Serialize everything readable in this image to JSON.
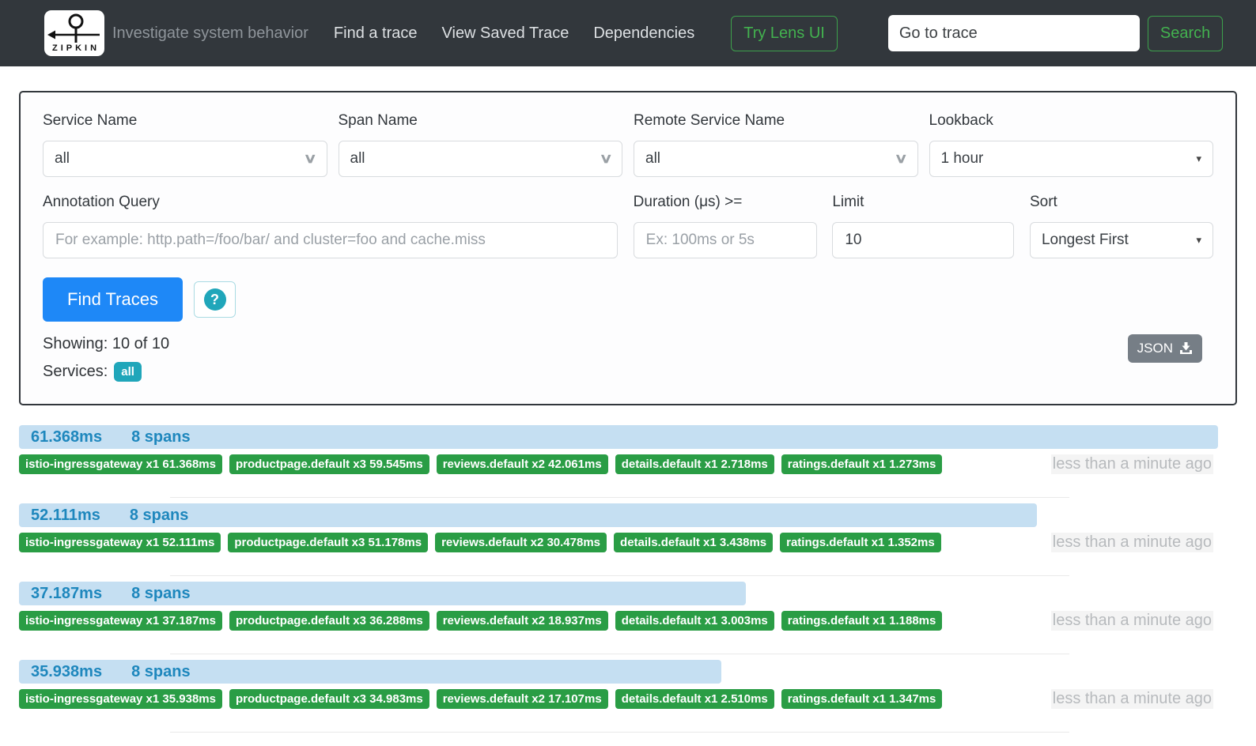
{
  "icons": {
    "chevron_down": "∨",
    "dropdown_arrow": "▾",
    "help_glyph": "?"
  },
  "header": {
    "logo_text": "ZIPKIN",
    "tagline": "Investigate system behavior",
    "nav": [
      {
        "label": "Find a trace"
      },
      {
        "label": "View Saved Trace"
      },
      {
        "label": "Dependencies"
      }
    ],
    "try_lens_label": "Try Lens UI",
    "go_to_trace_placeholder": "Go to trace",
    "search_label": "Search"
  },
  "filters": {
    "service_name": {
      "label": "Service Name",
      "value": "all"
    },
    "span_name": {
      "label": "Span Name",
      "value": "all"
    },
    "remote_service_name": {
      "label": "Remote Service Name",
      "value": "all"
    },
    "lookback": {
      "label": "Lookback",
      "value": "1 hour"
    },
    "annotation_query": {
      "label": "Annotation Query",
      "placeholder": "For example: http.path=/foo/bar/ and cluster=foo and cache.miss"
    },
    "duration": {
      "label": "Duration (μs) >=",
      "placeholder": "Ex: 100ms or 5s"
    },
    "limit": {
      "label": "Limit",
      "value": "10"
    },
    "sort": {
      "label": "Sort",
      "value": "Longest First"
    }
  },
  "actions": {
    "find_traces_label": "Find Traces",
    "showing_text": "Showing: 10 of 10",
    "services_label": "Services:",
    "services_badge": "all",
    "json_label": "JSON"
  },
  "traces": [
    {
      "duration": "61.368ms",
      "spans": "8 spans",
      "bar_width": "100%",
      "badges": [
        "istio-ingressgateway x1 61.368ms",
        "productpage.default x3 59.545ms",
        "reviews.default x2 42.061ms",
        "details.default x1 2.718ms",
        "ratings.default x1 1.273ms"
      ],
      "age": "less than a minute ago"
    },
    {
      "duration": "52.111ms",
      "spans": "8 spans",
      "bar_width": "84.9%",
      "badges": [
        "istio-ingressgateway x1 52.111ms",
        "productpage.default x3 51.178ms",
        "reviews.default x2 30.478ms",
        "details.default x1 3.438ms",
        "ratings.default x1 1.352ms"
      ],
      "age": "less than a minute ago"
    },
    {
      "duration": "37.187ms",
      "spans": "8 spans",
      "bar_width": "60.6%",
      "badges": [
        "istio-ingressgateway x1 37.187ms",
        "productpage.default x3 36.288ms",
        "reviews.default x2 18.937ms",
        "details.default x1 3.003ms",
        "ratings.default x1 1.188ms"
      ],
      "age": "less than a minute ago"
    },
    {
      "duration": "35.938ms",
      "spans": "8 spans",
      "bar_width": "58.6%",
      "badges": [
        "istio-ingressgateway x1 35.938ms",
        "productpage.default x3 34.983ms",
        "reviews.default x2 17.107ms",
        "details.default x1 2.510ms",
        "ratings.default x1 1.347ms"
      ],
      "age": "less than a minute ago"
    }
  ]
}
